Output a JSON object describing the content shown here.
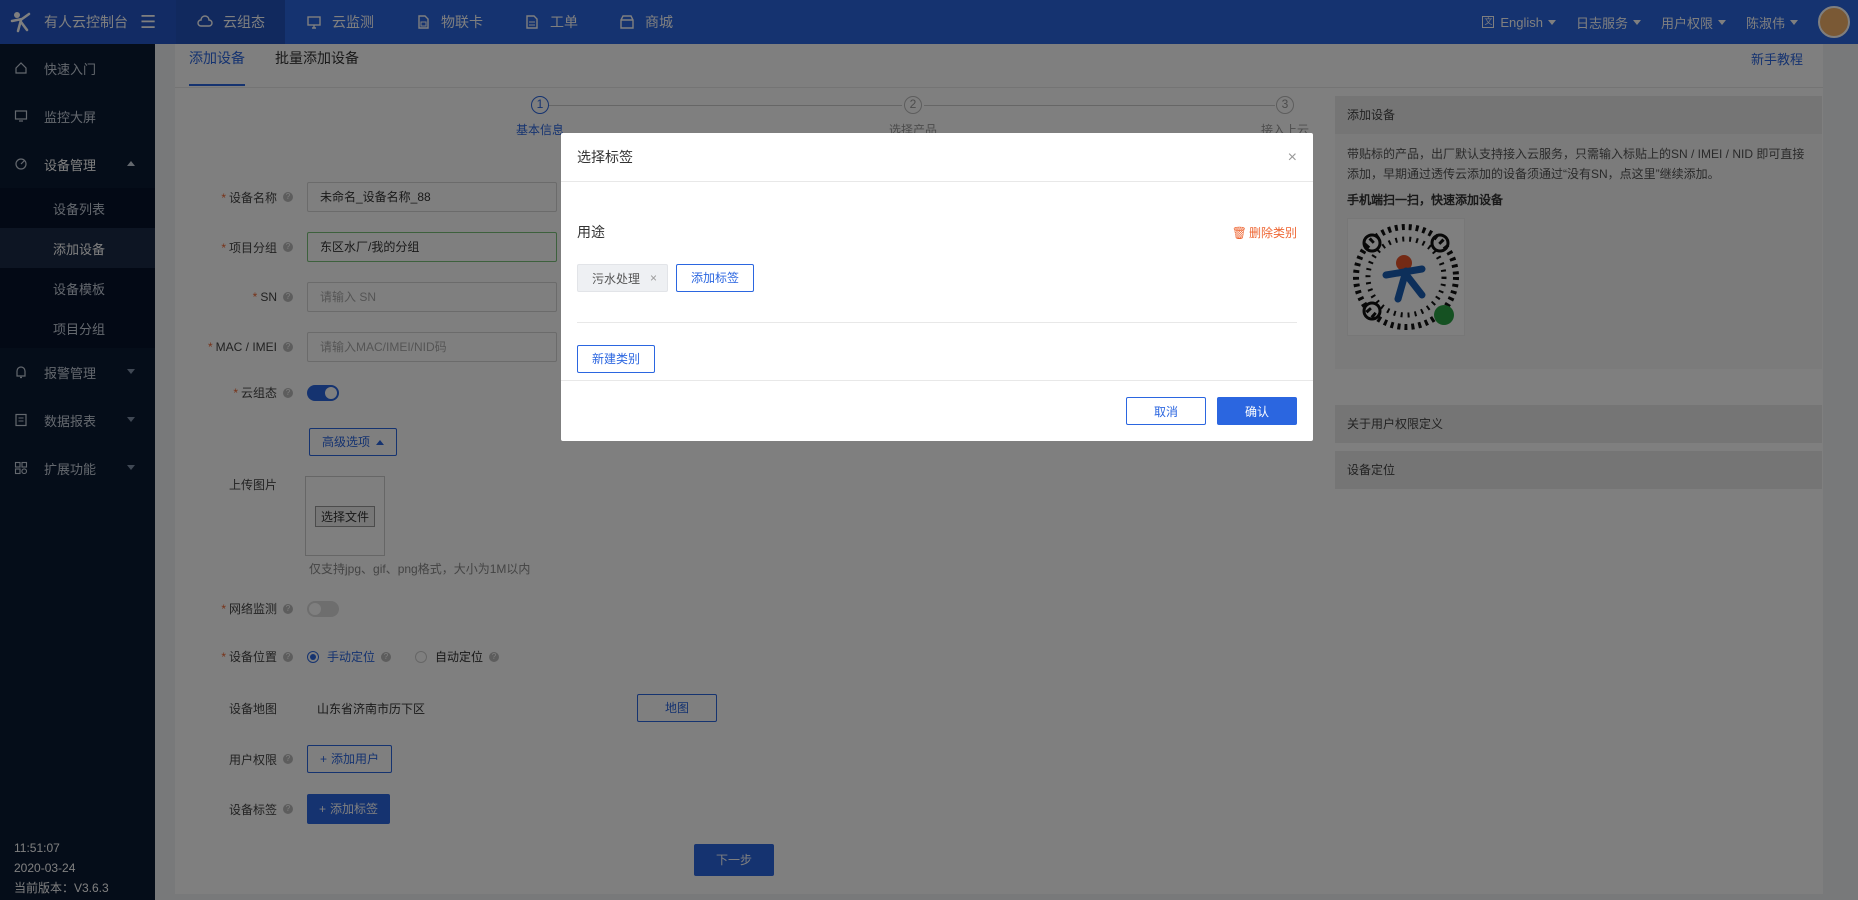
{
  "app": {
    "brand": "有人云控制台",
    "top_nav": [
      "云组态",
      "云监测",
      "物联卡",
      "工单",
      "商城"
    ],
    "language": "English",
    "log_service": "日志服务",
    "user_permission": "用户权限",
    "user_name": "陈淑伟"
  },
  "sidebar": {
    "items": [
      {
        "label": "快速入门"
      },
      {
        "label": "监控大屏"
      },
      {
        "label": "设备管理"
      },
      {
        "label": "报警管理"
      },
      {
        "label": "数据报表"
      },
      {
        "label": "扩展功能"
      }
    ],
    "device_sub": [
      "设备列表",
      "添加设备",
      "设备模板",
      "项目分组"
    ],
    "footer": {
      "time": "11:51:07",
      "date": "2020-03-24",
      "version": "当前版本：V3.6.3"
    }
  },
  "page": {
    "tabs": [
      "添加设备",
      "批量添加设备"
    ],
    "tutorial": "新手教程",
    "steps": [
      {
        "num": "1",
        "label": "基本信息"
      },
      {
        "num": "2",
        "label": "选择产品"
      },
      {
        "num": "3",
        "label": "接入上云"
      }
    ],
    "form": {
      "device_name_label": "设备名称",
      "device_name_value": "未命名_设备名称_88",
      "project_group_label": "项目分组",
      "project_group_value": "东区水厂/我的分组",
      "sn_label": "SN",
      "sn_placeholder": "请输入 SN",
      "mac_label": "MAC / IMEI",
      "mac_placeholder": "请输入MAC/IMEI/NID码",
      "cloud_state_label": "云组态",
      "advanced_label": "高级选项",
      "upload_label": "上传图片",
      "upload_btn": "选择文件",
      "upload_hint": "仅支持jpg、gif、png格式，大小为1M以内",
      "net_monitor_label": "网络监测",
      "location_label": "设备位置",
      "location_manual": "手动定位",
      "location_auto": "自动定位",
      "map_label": "设备地图",
      "map_value": "山东省济南市历下区",
      "map_btn": "地图",
      "user_perm_label": "用户权限",
      "add_user_btn": "添加用户",
      "device_tag_label": "设备标签",
      "add_tag_btn": "添加标签",
      "next_btn": "下一步"
    },
    "right_panel": {
      "title": "添加设备",
      "text": "带贴标的产品，出厂默认支持接入云服务，只需输入标贴上的SN / IMEI / NID 即可直接添加，早期通过透传云添加的设备须通过“没有SN，点这里”继续添加。",
      "scan": "手机端扫一扫，快速添加设备",
      "section2": "关于用户权限定义",
      "section3": "设备定位"
    }
  },
  "modal": {
    "title": "选择标签",
    "category": "用途",
    "delete_category": "删除类别",
    "tags": [
      "污水处理"
    ],
    "add_tag": "添加标签",
    "new_category": "新建类别",
    "cancel": "取消",
    "confirm": "确认"
  }
}
